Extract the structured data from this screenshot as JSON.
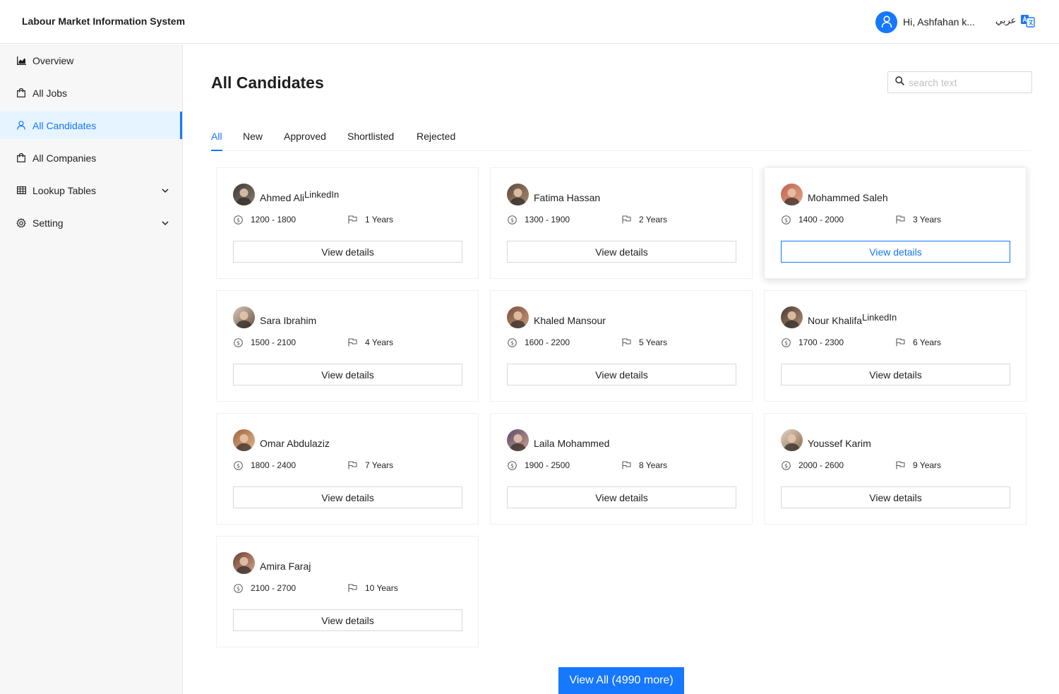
{
  "header": {
    "app_title": "Labour Market Information System",
    "greeting": "Hi, Ashfahan k...",
    "language_label": "عربي",
    "accent_color": "#1677ff"
  },
  "sidebar": {
    "items": [
      {
        "label": "Overview",
        "icon": "area-chart-icon"
      },
      {
        "label": "All Jobs",
        "icon": "shopping-bag-icon"
      },
      {
        "label": "All Candidates",
        "icon": "user-icon",
        "active": true
      },
      {
        "label": "All Companies",
        "icon": "shopping-bag-icon"
      },
      {
        "label": "Lookup Tables",
        "icon": "table-icon",
        "expandable": true
      },
      {
        "label": "Setting",
        "icon": "gear-icon",
        "expandable": true
      }
    ]
  },
  "main": {
    "title": "All Candidates",
    "search": {
      "placeholder": "search text",
      "value": ""
    },
    "tabs": [
      "All",
      "New",
      "Approved",
      "Shortlisted",
      "Rejected"
    ],
    "active_tab": "All",
    "view_details_label": "View details",
    "view_all_label": "View All (4990 more)"
  },
  "candidates": [
    {
      "name": "Ahmed Ali",
      "link": "LinkedIn",
      "salary": "1200 - 1800",
      "experience": "1 Years"
    },
    {
      "name": "Fatima Hassan",
      "link": "",
      "salary": "1300 - 1900",
      "experience": "2 Years"
    },
    {
      "name": "Mohammed Saleh",
      "link": "",
      "salary": "1400 - 2000",
      "experience": "3 Years",
      "hovered": true
    },
    {
      "name": "Sara Ibrahim",
      "link": "",
      "salary": "1500 - 2100",
      "experience": "4 Years"
    },
    {
      "name": "Khaled Mansour",
      "link": "",
      "salary": "1600 - 2200",
      "experience": "5 Years"
    },
    {
      "name": "Nour Khalifa",
      "link": "LinkedIn",
      "salary": "1700 - 2300",
      "experience": "6 Years"
    },
    {
      "name": "Omar Abdulaziz",
      "link": "",
      "salary": "1800 - 2400",
      "experience": "7 Years"
    },
    {
      "name": "Laila Mohammed",
      "link": "",
      "salary": "1900 - 2500",
      "experience": "8 Years"
    },
    {
      "name": "Youssef Karim",
      "link": "",
      "salary": "2000 - 2600",
      "experience": "9 Years"
    },
    {
      "name": "Amira Faraj",
      "link": "",
      "salary": "2100 - 2700",
      "experience": "10 Years"
    }
  ]
}
